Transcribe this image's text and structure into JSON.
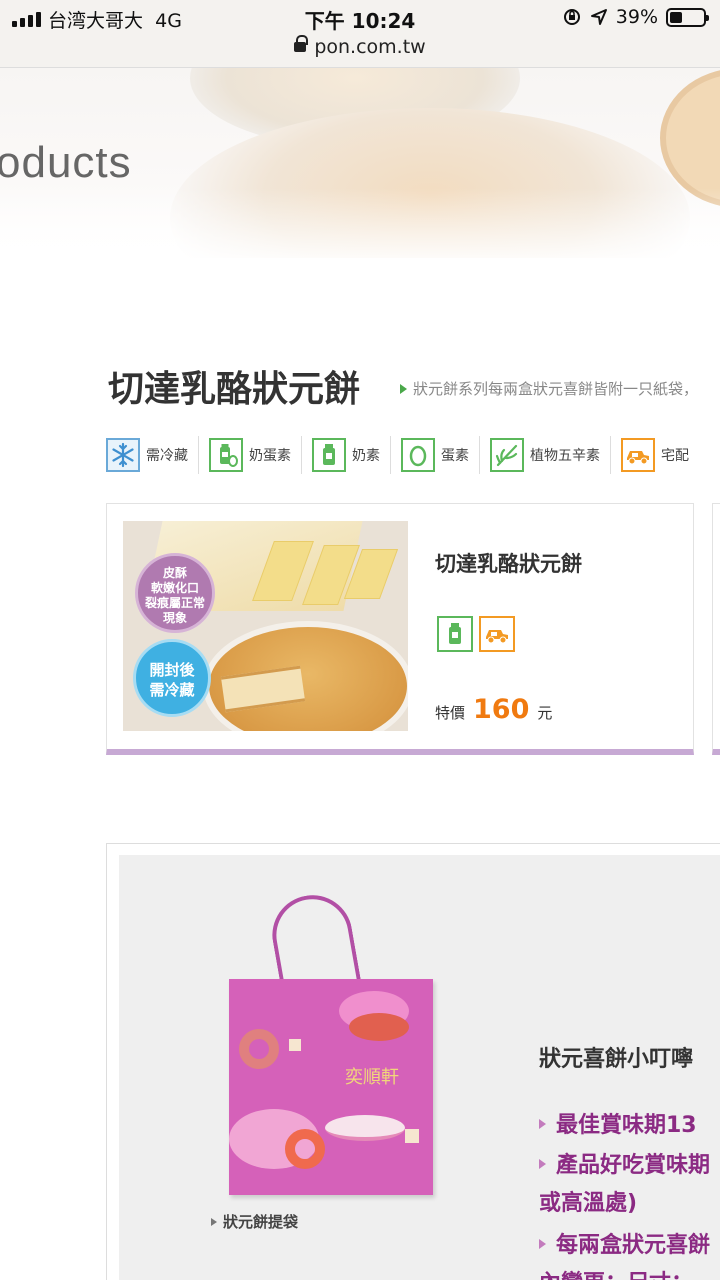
{
  "status_bar": {
    "carrier": "台湾大哥大",
    "network": "4G",
    "time": "下午 10:24",
    "url": "pon.com.tw",
    "battery": "39%"
  },
  "banner": {
    "text": "oducts"
  },
  "header": {
    "title": "切達乳酪狀元餅",
    "note": "狀元餅系列每兩盒狀元喜餅皆附一只紙袋，"
  },
  "legend": {
    "items": [
      {
        "label": "需冷藏",
        "icon": "snowflake-icon"
      },
      {
        "label": "奶蛋素",
        "icon": "milk-egg-icon"
      },
      {
        "label": "奶素",
        "icon": "milk-bottle-icon"
      },
      {
        "label": "蛋素",
        "icon": "egg-icon"
      },
      {
        "label": "植物五辛素",
        "icon": "plant-icon"
      },
      {
        "label": "宅配",
        "icon": "delivery-truck-icon"
      }
    ]
  },
  "product": {
    "name": "切達乳酪狀元餅",
    "badge_top": "皮酥\n軟嫩化口\n裂痕屬正常\n現象",
    "badge_bottom": "開封後\n需冷藏",
    "price_prefix": "特價",
    "price": "160",
    "price_unit": "元",
    "icons": [
      "milk-bottle-icon",
      "delivery-truck-icon"
    ]
  },
  "info": {
    "bag_logo": "奕順軒",
    "bag_label": "狀元餅提袋",
    "title": "狀元喜餅小叮嚀",
    "bullets": [
      "最佳賞味期13",
      "產品好吃賞味期",
      "或高溫處)",
      "每兩盒狀元喜餅",
      "內變更；尺寸："
    ]
  },
  "colors": {
    "accent_orange": "#f07a10",
    "accent_purple": "#8b2a83",
    "card_border": "#c7a9d4",
    "icon_green": "#5bb85b",
    "icon_blue": "#6aa9d8",
    "icon_orange": "#f39a23"
  }
}
